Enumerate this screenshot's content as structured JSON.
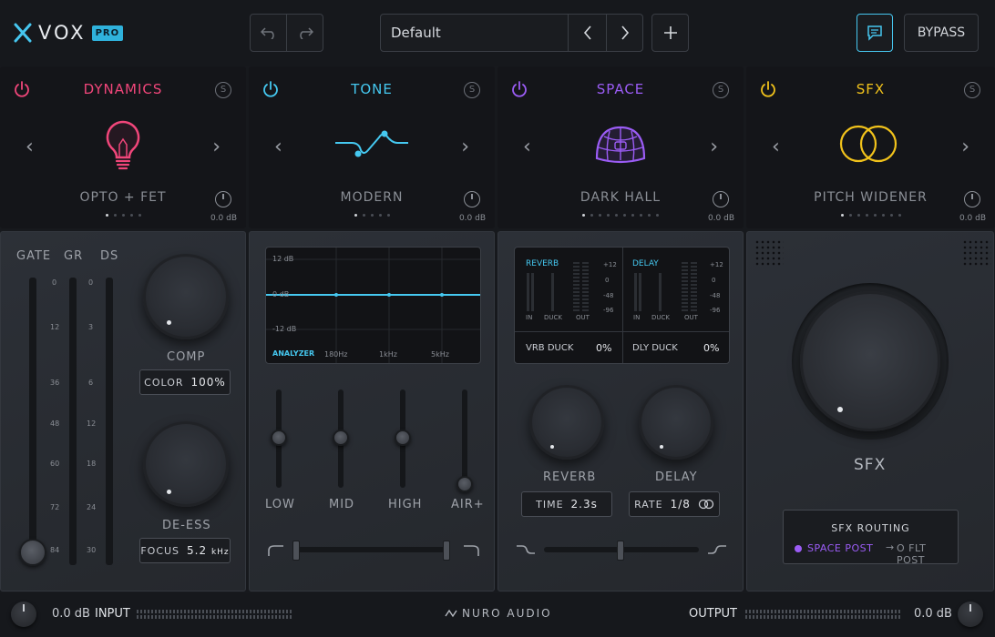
{
  "header": {
    "logo_text": "VOX",
    "logo_badge": "PRO",
    "preset_name": "Default",
    "bypass_label": "BYPASS"
  },
  "modules": [
    {
      "title": "DYNAMICS",
      "preset": "OPTO + FET",
      "gain": "0.0 dB",
      "color": "#f0467a",
      "badge": "S"
    },
    {
      "title": "TONE",
      "preset": "MODERN",
      "gain": "0.0 dB",
      "color": "#45c8f0",
      "badge": "S"
    },
    {
      "title": "SPACE",
      "preset": "DARK HALL",
      "gain": "0.0 dB",
      "color": "#9b5cf5",
      "badge": "S"
    },
    {
      "title": "SFX",
      "preset": "PITCH WIDENER",
      "gain": "0.0 dB",
      "color": "#f1c21b",
      "badge": "S"
    }
  ],
  "dynamics": {
    "meter_labels": [
      "GATE",
      "GR",
      "DS"
    ],
    "gate_scale": [
      "0",
      "12",
      "36",
      "48",
      "60",
      "72",
      "84"
    ],
    "ds_scale": [
      "0",
      "3",
      "6",
      "12",
      "18",
      "24",
      "30"
    ],
    "comp_label": "COMP",
    "color_label": "COLOR",
    "color_value": "100%",
    "deess_label": "DE-ESS",
    "focus_label": "FOCUS",
    "focus_value": "5.2",
    "focus_unit": "kHz"
  },
  "tone": {
    "eq_top": "12 dB",
    "eq_mid": "0 dB",
    "eq_bot": "-12 dB",
    "analyzer_label": "ANALYZER",
    "freqs": [
      "180Hz",
      "1kHz",
      "5kHz"
    ],
    "bands": [
      "LOW",
      "MID",
      "HIGH",
      "AIR+"
    ]
  },
  "space": {
    "reverb_title": "REVERB",
    "delay_title": "DELAY",
    "meter_io": [
      "IN",
      "DUCK",
      "OUT"
    ],
    "db_scale": [
      "+12",
      "0",
      "-48",
      "-96"
    ],
    "vrb_duck_label": "VRB DUCK",
    "vrb_duck_value": "0%",
    "dly_duck_label": "DLY DUCK",
    "dly_duck_value": "0%",
    "reverb_label": "REVERB",
    "delay_label": "DELAY",
    "time_label": "TIME",
    "time_value": "2.3s",
    "rate_label": "RATE",
    "rate_value": "1/8"
  },
  "sfx": {
    "knob_label": "SFX",
    "routing_title": "SFX ROUTING",
    "route_active": "SPACE POST",
    "route_inactive": "O FLT POST",
    "route_arrow": "→"
  },
  "footer": {
    "input_db": "0.0 dB",
    "input_label": "INPUT",
    "brand": "NURO AUDIO",
    "output_label": "OUTPUT",
    "output_db": "0.0 dB"
  }
}
